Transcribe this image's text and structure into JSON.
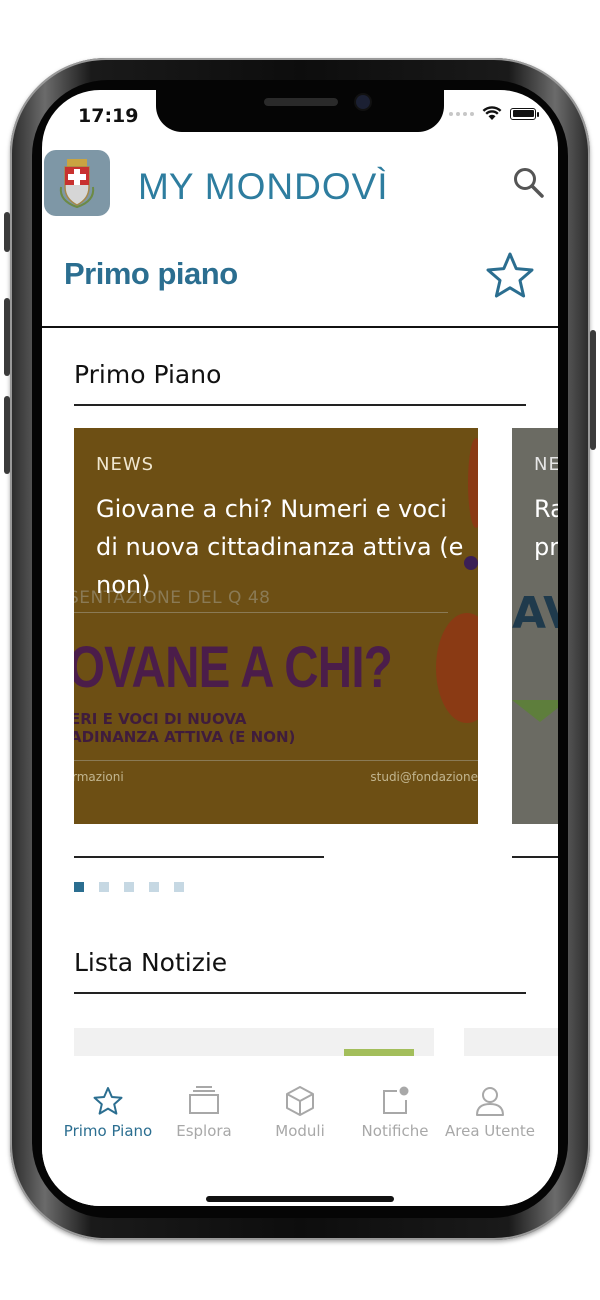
{
  "status_bar": {
    "time": "17:19"
  },
  "app": {
    "brand_my": "MY",
    "brand_name": "MONDOVÌ",
    "logo_icon": "city-crest-icon",
    "search_icon": "search-icon"
  },
  "header": {
    "title": "Primo piano",
    "favorite_icon": "star-icon"
  },
  "primo_piano": {
    "section_title": "Primo Piano",
    "cards": [
      {
        "label": "NEWS",
        "title": "Giovane a chi? Numeri e voci di nuova cittadinanza attiva (e non)",
        "poster": {
          "line1": "SENTAZIONE DEL Q 48",
          "big": "OVANE A CHI?",
          "sub1": "ERI E VOCI DI NUOVA",
          "sub2": "ADINANZA ATTIVA (E NON)",
          "foot_left": "rmazioni",
          "foot_right": "studi@fondazione"
        }
      },
      {
        "label": "NE",
        "title_line1": "Ra",
        "title_line2": "pr",
        "poster_big": "AV"
      }
    ],
    "pagination": {
      "count": 5,
      "active_index": 0
    }
  },
  "lista_notizie": {
    "section_title": "Lista Notizie"
  },
  "tabbar": {
    "items": [
      {
        "label": "Primo Piano",
        "icon": "star-icon",
        "active": true
      },
      {
        "label": "Esplora",
        "icon": "stack-icon",
        "active": false
      },
      {
        "label": "Moduli",
        "icon": "cube-icon",
        "active": false
      },
      {
        "label": "Notifiche",
        "icon": "notification-icon",
        "active": false
      },
      {
        "label": "Area Utente",
        "icon": "user-icon",
        "active": false
      }
    ]
  },
  "colors": {
    "accent": "#2b6e90",
    "brand": "#2e7d9f",
    "card_bg": "#6d4f14",
    "tab_inactive": "#a8a8a8"
  }
}
